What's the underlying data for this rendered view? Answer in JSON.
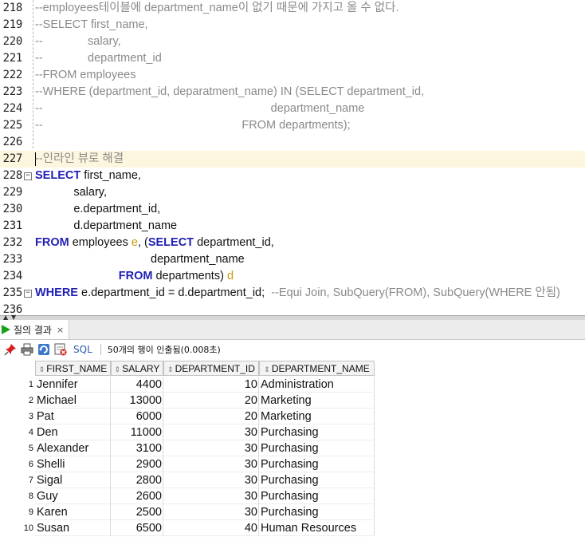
{
  "editor": {
    "lines": [
      {
        "num": "218",
        "parts": [
          {
            "t": "--employees테이블에 department_name이 없기 때문에 가지고 올 수 없다.",
            "c": "cm"
          }
        ]
      },
      {
        "num": "219",
        "parts": [
          {
            "t": "--SELECT first_name,",
            "c": "cm"
          }
        ]
      },
      {
        "num": "220",
        "parts": [
          {
            "t": "--              salary,",
            "c": "cm"
          }
        ]
      },
      {
        "num": "221",
        "parts": [
          {
            "t": "--              department_id",
            "c": "cm"
          }
        ]
      },
      {
        "num": "222",
        "parts": [
          {
            "t": "--FROM employees",
            "c": "cm"
          }
        ]
      },
      {
        "num": "223",
        "parts": [
          {
            "t": "--WHERE (department_id, deparatment_name) IN (SELECT department_id,",
            "c": "cm"
          }
        ]
      },
      {
        "num": "224",
        "parts": [
          {
            "t": "--                                                                       department_name",
            "c": "cm"
          }
        ]
      },
      {
        "num": "225",
        "parts": [
          {
            "t": "--                                                              FROM departments);",
            "c": "cm"
          }
        ]
      },
      {
        "num": "226",
        "parts": []
      },
      {
        "num": "227",
        "current": true,
        "parts": [
          {
            "t": "--인라인 뷰로 해결",
            "c": "cm"
          }
        ]
      },
      {
        "num": "228",
        "fold": "−",
        "parts": [
          {
            "t": "SELECT",
            "c": "kw"
          },
          {
            "t": " first_name,",
            "c": ""
          }
        ]
      },
      {
        "num": "229",
        "parts": [
          {
            "t": "            salary,",
            "c": ""
          }
        ]
      },
      {
        "num": "230",
        "parts": [
          {
            "t": "            e.department_id,",
            "c": ""
          }
        ]
      },
      {
        "num": "231",
        "parts": [
          {
            "t": "            d.department_name",
            "c": ""
          }
        ]
      },
      {
        "num": "232",
        "parts": [
          {
            "t": "FROM",
            "c": "kw"
          },
          {
            "t": " employees ",
            "c": ""
          },
          {
            "t": "e",
            "c": "al"
          },
          {
            "t": ", (",
            "c": ""
          },
          {
            "t": "SELECT",
            "c": "kw"
          },
          {
            "t": " department_id,",
            "c": ""
          }
        ]
      },
      {
        "num": "233",
        "parts": [
          {
            "t": "                                    department_name",
            "c": ""
          }
        ]
      },
      {
        "num": "234",
        "parts": [
          {
            "t": "                          ",
            "c": ""
          },
          {
            "t": "FROM",
            "c": "kw"
          },
          {
            "t": " departments) ",
            "c": ""
          },
          {
            "t": "d",
            "c": "al"
          }
        ]
      },
      {
        "num": "235",
        "fold": "−",
        "parts": [
          {
            "t": "WHERE",
            "c": "kw"
          },
          {
            "t": " e.department_id = d.department_id;  ",
            "c": ""
          },
          {
            "t": "--Equi Join, SubQuery(FROM), SubQuery(WHERE 안됨)",
            "c": "cm"
          }
        ]
      },
      {
        "num": "236",
        "parts": []
      }
    ]
  },
  "results": {
    "tab_label": "질의 결과",
    "tab_close": "×",
    "sql_label": "SQL",
    "status": "50개의 행이 인출됨(0.008초)",
    "columns": [
      "FIRST_NAME",
      "SALARY",
      "DEPARTMENT_ID",
      "DEPARTMENT_NAME"
    ],
    "rows": [
      [
        "1",
        "Jennifer",
        "4400",
        "10",
        "Administration"
      ],
      [
        "2",
        "Michael",
        "13000",
        "20",
        "Marketing"
      ],
      [
        "3",
        "Pat",
        "6000",
        "20",
        "Marketing"
      ],
      [
        "4",
        "Den",
        "11000",
        "30",
        "Purchasing"
      ],
      [
        "5",
        "Alexander",
        "3100",
        "30",
        "Purchasing"
      ],
      [
        "6",
        "Shelli",
        "2900",
        "30",
        "Purchasing"
      ],
      [
        "7",
        "Sigal",
        "2800",
        "30",
        "Purchasing"
      ],
      [
        "8",
        "Guy",
        "2600",
        "30",
        "Purchasing"
      ],
      [
        "9",
        "Karen",
        "2500",
        "30",
        "Purchasing"
      ],
      [
        "10",
        "Susan",
        "6500",
        "40",
        "Human Resources"
      ]
    ]
  },
  "colors": {
    "keyword": "#1f1fb5",
    "comment": "#8a8a8a",
    "alias": "#c99a06",
    "current_line": "#fdf6df",
    "run_icon": "#19a019"
  }
}
